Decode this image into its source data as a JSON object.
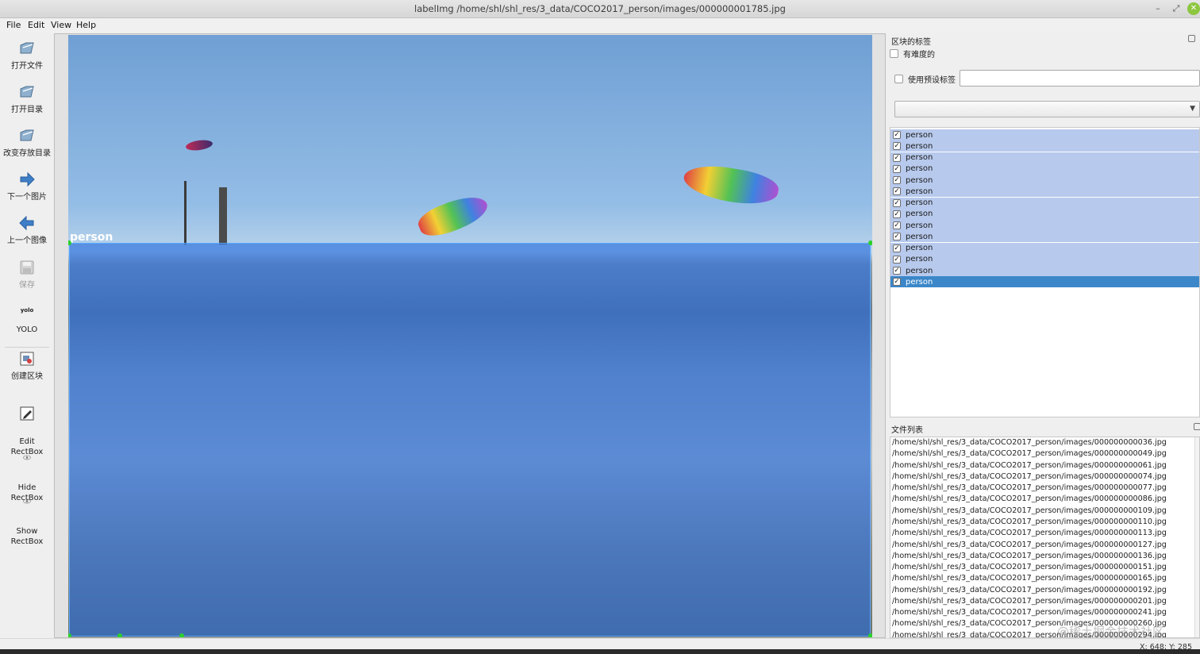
{
  "window": {
    "title": "labelImg /home/shl/shl_res/3_data/COCO2017_person/images/000000001785.jpg",
    "minimize": "–",
    "maximize": "⤢",
    "close": "✕"
  },
  "menu": [
    "File",
    "Edit",
    "View",
    "Help"
  ],
  "toolbar": {
    "open_file": "打开文件",
    "open_dir": "打开目录",
    "change_save_dir": "改变存放目录",
    "next_image": "下一个图片",
    "prev_image": "上一个图像",
    "save": "保存",
    "format_icon_text": "yolo",
    "format": "YOLO",
    "create_box": "创建区块",
    "edit_rectbox": "Edit\nRectBox",
    "hide_rectbox": "Hide\nRectBox",
    "show_rectbox": "Show\nRectBox"
  },
  "canvas": {
    "selected_label": "person"
  },
  "box_labels_dock": {
    "title": "区块的标签",
    "difficult_label": "有难度的",
    "use_default_label": "使用预设标签",
    "default_label_value": "",
    "combo_value": "",
    "labels": [
      {
        "text": "person",
        "checked": true
      },
      {
        "text": "person",
        "checked": true
      },
      {
        "text": "person",
        "checked": true
      },
      {
        "text": "person",
        "checked": true
      },
      {
        "text": "person",
        "checked": true
      },
      {
        "text": "person",
        "checked": true
      },
      {
        "text": "person",
        "checked": true
      },
      {
        "text": "person",
        "checked": true
      },
      {
        "text": "person",
        "checked": true
      },
      {
        "text": "person",
        "checked": true
      },
      {
        "text": "person",
        "checked": true
      },
      {
        "text": "person",
        "checked": true
      },
      {
        "text": "person",
        "checked": true
      },
      {
        "text": "person",
        "checked": true,
        "selected": true
      }
    ]
  },
  "file_list_dock": {
    "title": "文件列表",
    "files": [
      "/home/shl/shl_res/3_data/COCO2017_person/images/000000000036.jpg",
      "/home/shl/shl_res/3_data/COCO2017_person/images/000000000049.jpg",
      "/home/shl/shl_res/3_data/COCO2017_person/images/000000000061.jpg",
      "/home/shl/shl_res/3_data/COCO2017_person/images/000000000074.jpg",
      "/home/shl/shl_res/3_data/COCO2017_person/images/000000000077.jpg",
      "/home/shl/shl_res/3_data/COCO2017_person/images/000000000086.jpg",
      "/home/shl/shl_res/3_data/COCO2017_person/images/000000000109.jpg",
      "/home/shl/shl_res/3_data/COCO2017_person/images/000000000110.jpg",
      "/home/shl/shl_res/3_data/COCO2017_person/images/000000000113.jpg",
      "/home/shl/shl_res/3_data/COCO2017_person/images/000000000127.jpg",
      "/home/shl/shl_res/3_data/COCO2017_person/images/000000000136.jpg",
      "/home/shl/shl_res/3_data/COCO2017_person/images/000000000151.jpg",
      "/home/shl/shl_res/3_data/COCO2017_person/images/000000000165.jpg",
      "/home/shl/shl_res/3_data/COCO2017_person/images/000000000192.jpg",
      "/home/shl/shl_res/3_data/COCO2017_person/images/000000000201.jpg",
      "/home/shl/shl_res/3_data/COCO2017_person/images/000000000241.jpg",
      "/home/shl/shl_res/3_data/COCO2017_person/images/000000000260.jpg",
      "/home/shl/shl_res/3_data/COCO2017_person/images/000000000294.jpg"
    ],
    "watermark": "@稀土掘金技术社区"
  },
  "status": {
    "coords": "X: 648; Y: 285"
  },
  "colors": {
    "box_fill": "#2369dc",
    "handle": "#2cd12c",
    "selection": "#3b87c9",
    "label_row": "#b7c9ec"
  }
}
